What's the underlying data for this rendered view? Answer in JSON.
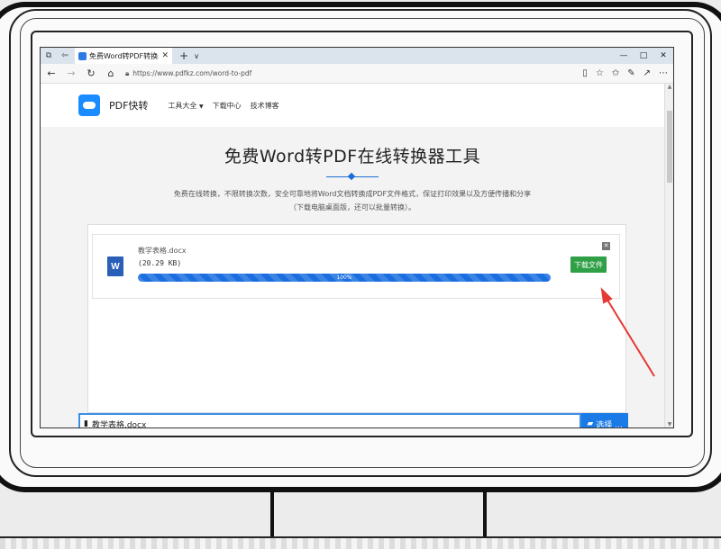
{
  "browser": {
    "tab_title": "免费Word转PDF转换器",
    "address_url": "https://www.pdfkz.com/word-to-pdf",
    "window_controls": [
      "—",
      "□",
      "✕"
    ]
  },
  "site": {
    "logo_text": "PDF快转",
    "nav": [
      "工具大全",
      "下载中心",
      "技术博客"
    ]
  },
  "hero": {
    "title": "免费Word转PDF在线转换器工具",
    "description": "免费在线转换，不限转换次数，安全可靠地将Word文档转换成PDF文件格式，保证打印效果以及方便传播和分享（下载电脑桌面版，还可以批量转换）。"
  },
  "file_card": {
    "filename": "教学表格.docx",
    "filesize": "(20.29 KB)",
    "progress_label": "100%",
    "progress": 1.0,
    "download_label": "下载文件",
    "word_letter": "W"
  },
  "file_input": {
    "value": "教学表格.docx",
    "choose_label": "选择 ..."
  },
  "colors": {
    "accent": "#1a7ae6",
    "download": "#2fa045",
    "annotation": "#e53935"
  }
}
